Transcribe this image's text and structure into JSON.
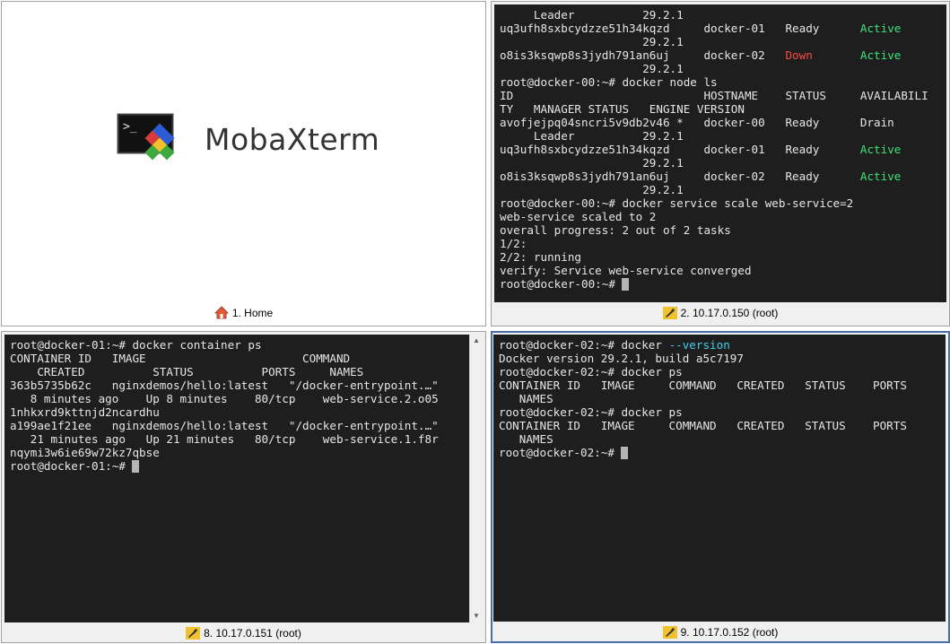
{
  "home": {
    "app_name": "MobaXterm",
    "tab_label": "1. Home",
    "icon": "home-icon"
  },
  "panes": [
    {
      "tab_label": "2. 10.17.0.150 (root)",
      "icon": "wrench-icon",
      "lines": [
        [
          {
            "t": "     Leader          29.2.1"
          }
        ],
        [
          {
            "t": "uq3ufh8sxbcydzze51h34kqzd     docker-01   Ready      "
          },
          {
            "t": "Active",
            "c": "green"
          }
        ],
        [
          {
            "t": "                     29.2.1"
          }
        ],
        [
          {
            "t": "o8is3ksqwp8s3jydh791an6uj     docker-02   "
          },
          {
            "t": "Down",
            "c": "red"
          },
          {
            "t": "       "
          },
          {
            "t": "Active",
            "c": "green"
          }
        ],
        [
          {
            "t": "                     29.2.1"
          }
        ],
        [
          {
            "t": "root@docker-00:~# docker node ls"
          }
        ],
        [
          {
            "t": "ID                            HOSTNAME    STATUS     AVAILABILI"
          }
        ],
        [
          {
            "t": "TY   MANAGER STATUS   ENGINE VERSION"
          }
        ],
        [
          {
            "t": "avofjejpq04sncri5v9db2v46 *   docker-00   Ready      Drain"
          }
        ],
        [
          {
            "t": "     Leader          29.2.1"
          }
        ],
        [
          {
            "t": "uq3ufh8sxbcydzze51h34kqzd     docker-01   Ready      "
          },
          {
            "t": "Active",
            "c": "green"
          }
        ],
        [
          {
            "t": "                     29.2.1"
          }
        ],
        [
          {
            "t": "o8is3ksqwp8s3jydh791an6uj     docker-02   Ready      "
          },
          {
            "t": "Active",
            "c": "green"
          }
        ],
        [
          {
            "t": "                     29.2.1"
          }
        ],
        [
          {
            "t": "root@docker-00:~# docker service scale web-service=2"
          }
        ],
        [
          {
            "t": "web-service scaled to 2"
          }
        ],
        [
          {
            "t": "overall progress: 2 out of 2 tasks"
          }
        ],
        [
          {
            "t": "1/2:"
          }
        ],
        [
          {
            "t": "2/2: running"
          }
        ],
        [
          {
            "t": "verify: Service web-service converged"
          }
        ],
        [
          {
            "t": "root@docker-00:~# "
          },
          {
            "cursor": true
          }
        ]
      ]
    },
    {
      "tab_label": "8. 10.17.0.151 (root)",
      "icon": "wrench-icon",
      "lines": [
        [
          {
            "t": "root@docker-01:~# docker container ps"
          }
        ],
        [
          {
            "t": "CONTAINER ID   IMAGE                       COMMAND"
          }
        ],
        [
          {
            "t": "    CREATED          STATUS          PORTS     NAMES"
          }
        ],
        [
          {
            "t": "363b5735b62c   nginxdemos/hello:latest   \"/docker-entrypoint.…\""
          }
        ],
        [
          {
            "t": "   8 minutes ago    Up 8 minutes    80/tcp    web-service.2.o05"
          }
        ],
        [
          {
            "t": "1nhkxrd9kttnjd2ncardhu"
          }
        ],
        [
          {
            "t": "a199ae1f21ee   nginxdemos/hello:latest   \"/docker-entrypoint.…\""
          }
        ],
        [
          {
            "t": "   21 minutes ago   Up 21 minutes   80/tcp    web-service.1.f8r"
          }
        ],
        [
          {
            "t": "nqymi3w6ie69w72kz7qbse"
          }
        ],
        [
          {
            "t": "root@docker-01:~# "
          },
          {
            "cursor": true
          }
        ]
      ]
    },
    {
      "tab_label": "9. 10.17.0.152 (root)",
      "icon": "wrench-icon",
      "lines": [
        [
          {
            "t": "root@docker-02:~# docker "
          },
          {
            "t": "--version",
            "c": "cyan"
          }
        ],
        [
          {
            "t": "Docker version 29.2.1, build a5c7197"
          }
        ],
        [
          {
            "t": "root@docker-02:~# docker ps"
          }
        ],
        [
          {
            "t": "CONTAINER ID   IMAGE     COMMAND   CREATED   STATUS    PORTS"
          }
        ],
        [
          {
            "t": "   NAMES"
          }
        ],
        [
          {
            "t": "root@docker-02:~# docker ps"
          }
        ],
        [
          {
            "t": "CONTAINER ID   IMAGE     COMMAND   CREATED   STATUS    PORTS"
          }
        ],
        [
          {
            "t": "   NAMES"
          }
        ],
        [
          {
            "t": "root@docker-02:~# "
          },
          {
            "cursor": true
          }
        ]
      ]
    }
  ],
  "colors": {
    "terminal_bg": "#1e1e1e",
    "terminal_fg": "#e6e6e6",
    "active_green": "#3fe07a",
    "down_red": "#ff4a4a",
    "option_cyan": "#3fd0e8",
    "active_pane_border": "#4a6fa5"
  }
}
